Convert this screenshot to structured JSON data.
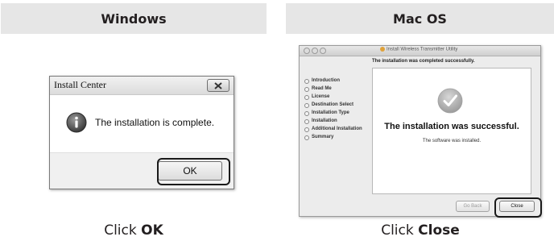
{
  "headers": {
    "windows": "Windows",
    "mac": "Mac OS"
  },
  "windows_dialog": {
    "title": "Install Center",
    "message": "The installation is complete.",
    "ok_label": "OK"
  },
  "mac_window": {
    "title": "Install Wireless Transmitter Utility",
    "subtitle": "The installation was completed successfully.",
    "steps": [
      "Introduction",
      "Read Me",
      "License",
      "Destination Select",
      "Installation Type",
      "Installation",
      "Additional Installation",
      "Summary"
    ],
    "success_heading": "The installation was successful.",
    "installed_text": "The software was installed.",
    "go_back_label": "Go Back",
    "close_label": "Close"
  },
  "captions": {
    "windows_prefix": "Click ",
    "windows_action": "OK",
    "mac_prefix": "Click ",
    "mac_action": "Close"
  }
}
